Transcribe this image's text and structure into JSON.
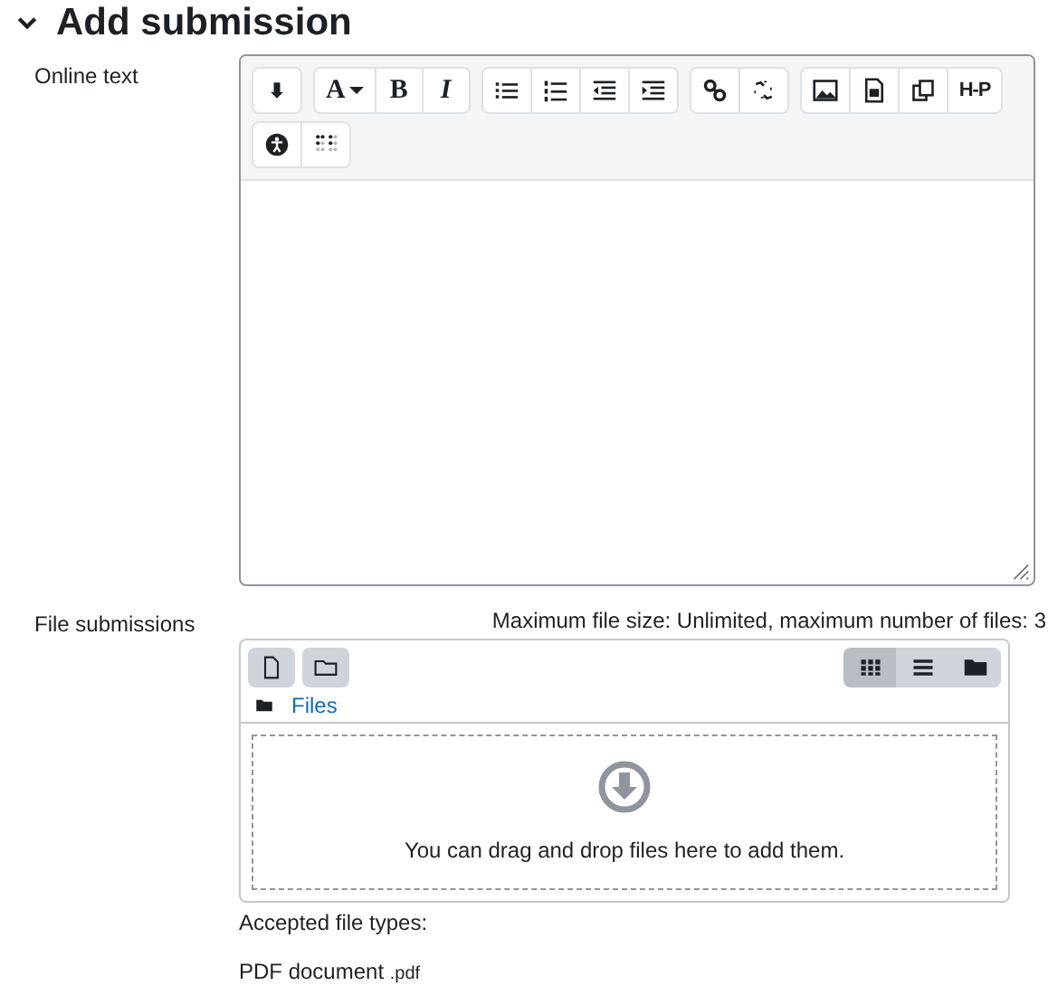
{
  "heading": {
    "title": "Add submission",
    "expanded": true
  },
  "online_text": {
    "label": "Online text",
    "toolbar_groups": [
      [
        {
          "kind": "icon"
        }
      ],
      [
        {
          "kind": "dropdown",
          "text": "A"
        },
        {
          "kind": "bold",
          "text": "B"
        },
        {
          "kind": "italic",
          "text": "I"
        }
      ],
      [
        {
          "kind": "icon"
        },
        {
          "kind": "icon"
        },
        {
          "kind": "icon"
        },
        {
          "kind": "icon"
        }
      ],
      [
        {
          "kind": "icon"
        },
        {
          "kind": "icon"
        }
      ],
      [
        {
          "kind": "icon"
        },
        {
          "kind": "icon"
        },
        {
          "kind": "icon"
        },
        {
          "kind": "logo",
          "text": "H-P"
        }
      ],
      [
        {
          "kind": "icon"
        },
        {
          "kind": "icon"
        }
      ]
    ]
  },
  "file_submissions": {
    "label": "File submissions",
    "limits": "Maximum file size: Unlimited, maximum number of files: 3",
    "views": [
      {
        "selected": true
      },
      {
        "selected": false
      },
      {
        "selected": false
      }
    ],
    "path": "Files",
    "drop_hint": "You can drag and drop files here to add them.",
    "accepted_label": "Accepted file types:",
    "accepted": [
      {
        "name": "PDF document",
        "ext": ".pdf"
      }
    ]
  }
}
